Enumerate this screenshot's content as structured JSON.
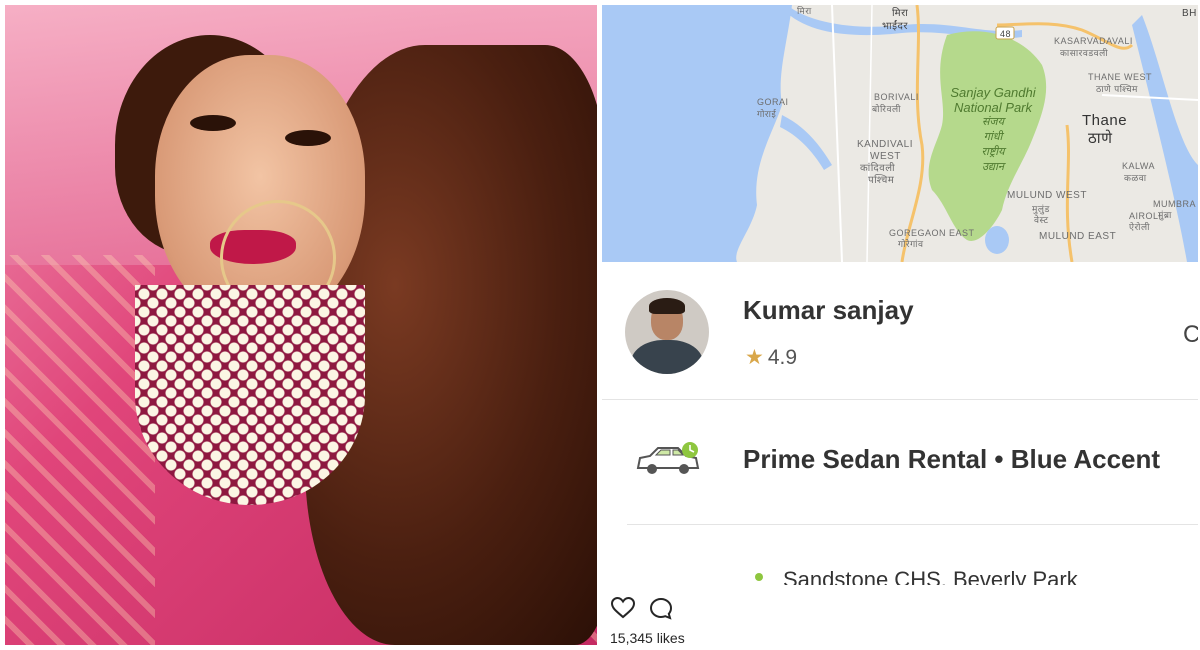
{
  "map": {
    "labels": [
      {
        "id": "mira",
        "text": "मिरा"
      },
      {
        "id": "bhayandar",
        "text": "भाईंदर"
      },
      {
        "id": "highway",
        "text": "48"
      },
      {
        "id": "kasarvadavali",
        "text": "KASARVADAVALI"
      },
      {
        "id": "kasarvadavali_dev",
        "text": "कासारवडवली"
      },
      {
        "id": "thane_west",
        "text": "THANE WEST"
      },
      {
        "id": "thane_west_dev",
        "text": "ठाणे पश्चिम"
      },
      {
        "id": "gorai",
        "text": "GORAI"
      },
      {
        "id": "gorai_dev",
        "text": "गोराई"
      },
      {
        "id": "borivali",
        "text": "BORIVALI"
      },
      {
        "id": "borivali_dev",
        "text": "बोरिवली"
      },
      {
        "id": "kandivali",
        "text": "KANDIVALI"
      },
      {
        "id": "kandivali_west",
        "text": "WEST"
      },
      {
        "id": "kandivali_dev",
        "text": "कांदिवली"
      },
      {
        "id": "kandivali_dev2",
        "text": "पश्चिम"
      },
      {
        "id": "thane",
        "text": "Thane"
      },
      {
        "id": "thane_dev",
        "text": "ठाणे"
      },
      {
        "id": "kalwa",
        "text": "KALWA"
      },
      {
        "id": "kalwa_dev",
        "text": "कळवा"
      },
      {
        "id": "mulund_west",
        "text": "MULUND WEST"
      },
      {
        "id": "mulund_west_dev",
        "text": "मुलुंड"
      },
      {
        "id": "mulund_west_dev2",
        "text": "वेस्ट"
      },
      {
        "id": "mulund_east",
        "text": "MULUND EAST"
      },
      {
        "id": "airoli",
        "text": "AIROLI"
      },
      {
        "id": "airoli_dev",
        "text": "ऐरोली"
      },
      {
        "id": "mumbra",
        "text": "MUMBRA"
      },
      {
        "id": "mumbra_dev",
        "text": "मुंब्रा"
      },
      {
        "id": "goregaon_east",
        "text": "GOREGAON EAST"
      },
      {
        "id": "goregaon_east_dev",
        "text": "गोरेगांव"
      },
      {
        "id": "bh",
        "text": "BH"
      }
    ],
    "park_label": [
      "Sanjay Gandhi",
      "National Park",
      "संजय",
      "गांधी",
      "राष्ट्रीय",
      "उद्यान"
    ]
  },
  "driver": {
    "name": "Kumar sanjay",
    "rating": "4.9",
    "star": "★",
    "cut_off_text": "C"
  },
  "ride": {
    "car_type": "Prime Sedan Rental • Blue Accent"
  },
  "pickup": {
    "address": "Sandstone CHS, Beverly Park"
  },
  "instagram": {
    "likes": "15,345 likes"
  },
  "colors": {
    "pickup_dot": "#8ec63f",
    "star": "#d9a74a",
    "park_green": "#b5d98c",
    "water": "#a9c9f5"
  }
}
